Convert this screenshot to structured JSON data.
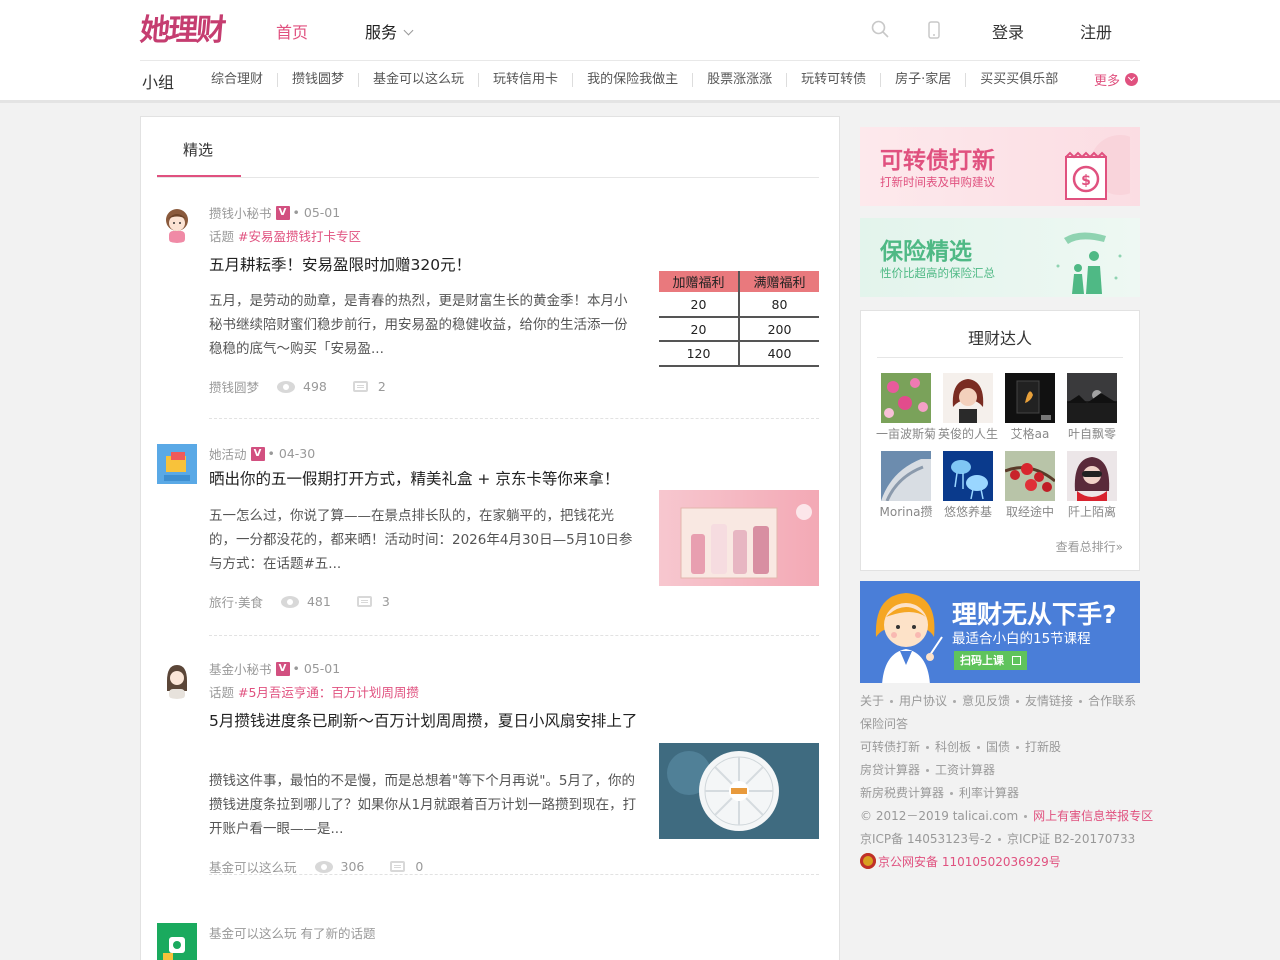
{
  "header": {
    "logo": "她理财",
    "nav_home": "首页",
    "nav_service": "服务",
    "login": "登录",
    "register": "注册"
  },
  "groups": {
    "label": "小组",
    "items": [
      "综合理财",
      "攒钱圆梦",
      "基金可以这么玩",
      "玩转信用卡",
      "我的保险我做主",
      "股票涨涨涨",
      "玩转可转债",
      "房子·家居",
      "买买买俱乐部"
    ],
    "more": "更多"
  },
  "main": {
    "tab": "精选",
    "posts": [
      {
        "author": "攒钱小秘书",
        "badge": "V",
        "date": "• 05-01",
        "topic_prefix": "话题 ",
        "topic": "#安易盈攒钱打卡专区",
        "title": "五月耕耘季！安易盈限时加赠320元！",
        "summary": "五月，是劳动的勋章，是青春的热烈，更是财富生长的黄金季！本月小秘书继续陪财蜜们稳步前行，用安易盈的稳健收益，给你的生活添一份稳稳的底气～购买「安易盈...",
        "group": "攒钱圆梦",
        "views": "498",
        "comments": "2",
        "thumb_table": {
          "headers": [
            "加赠福利",
            "满赠福利"
          ],
          "rows": [
            [
              "20",
              "80"
            ],
            [
              "20",
              "200"
            ],
            [
              "120",
              "400"
            ]
          ]
        }
      },
      {
        "author": "她活动",
        "badge": "V",
        "date": "• 04-30",
        "title": "晒出你的五一假期打开方式，精美礼盒 + 京东卡等你来拿！",
        "summary": "五一怎么过，你说了算——在景点排长队的，在家躺平的，把钱花光的，一分都没花的，都来晒！活动时间：2026年4月30日—5月10日参与方式：在话题#五...",
        "group": "旅行·美食",
        "views": "481",
        "comments": "3",
        "avatar_text": "她活动"
      },
      {
        "author": "基金小秘书",
        "badge": "V",
        "date": "• 05-01",
        "topic_prefix": "话题 ",
        "topic": "#5月吾运亨通：百万计划周周攒",
        "title": "5月攒钱进度条已刷新～百万计划周周攒，夏日小风扇安排上了",
        "summary": "攒钱这件事，最怕的不是慢，而是总想着\"等下个月再说\"。5月了，你的攒钱进度条拉到哪儿了？如果你从1月就跟着百万计划一路攒到现在，打开账户看一眼——是...",
        "group": "基金可以这么玩",
        "views": "306",
        "comments": "0"
      },
      {
        "notice": "基金可以这么玩 有了新的话题"
      }
    ]
  },
  "sidebar": {
    "banner1": {
      "title": "可转债打新",
      "subtitle": "打新时间表及申购建议"
    },
    "banner2": {
      "title": "保险精选",
      "subtitle": "性价比超高的保险汇总"
    },
    "experts": {
      "title": "理财达人",
      "people": [
        "一亩波斯菊",
        "英俊的人生",
        "艾格aa",
        "叶自飘零",
        "Morina攒",
        "悠悠养基",
        "取经途中",
        "阡上陌离"
      ],
      "rank_link": "查看总排行»"
    },
    "course": {
      "title": "理财无从下手?",
      "subtitle": "最适合小白的15节课程",
      "button": "扫码上课"
    },
    "footer": {
      "row1": [
        "关于",
        "用户协议",
        "意见反馈",
        "友情链接",
        "合作联系"
      ],
      "row2": [
        "保险问答"
      ],
      "row3": [
        "可转债打新",
        "科创板",
        "国债",
        "打新股"
      ],
      "row4": [
        "房贷计算器",
        "工资计算器"
      ],
      "row5": [
        "新房税费计算器",
        "利率计算器"
      ],
      "copyright": "© 2012－2019 talicai.com",
      "report": "网上有害信息举报专区",
      "icp": "京ICP备 14053123号-2",
      "icp2": "京ICP证 B2-20170733",
      "police": "京公网安备 11010502036929号"
    }
  },
  "colors": {
    "brand": "#e0517f",
    "logo": "#c53d70",
    "course_bg": "#4a7ed8"
  }
}
